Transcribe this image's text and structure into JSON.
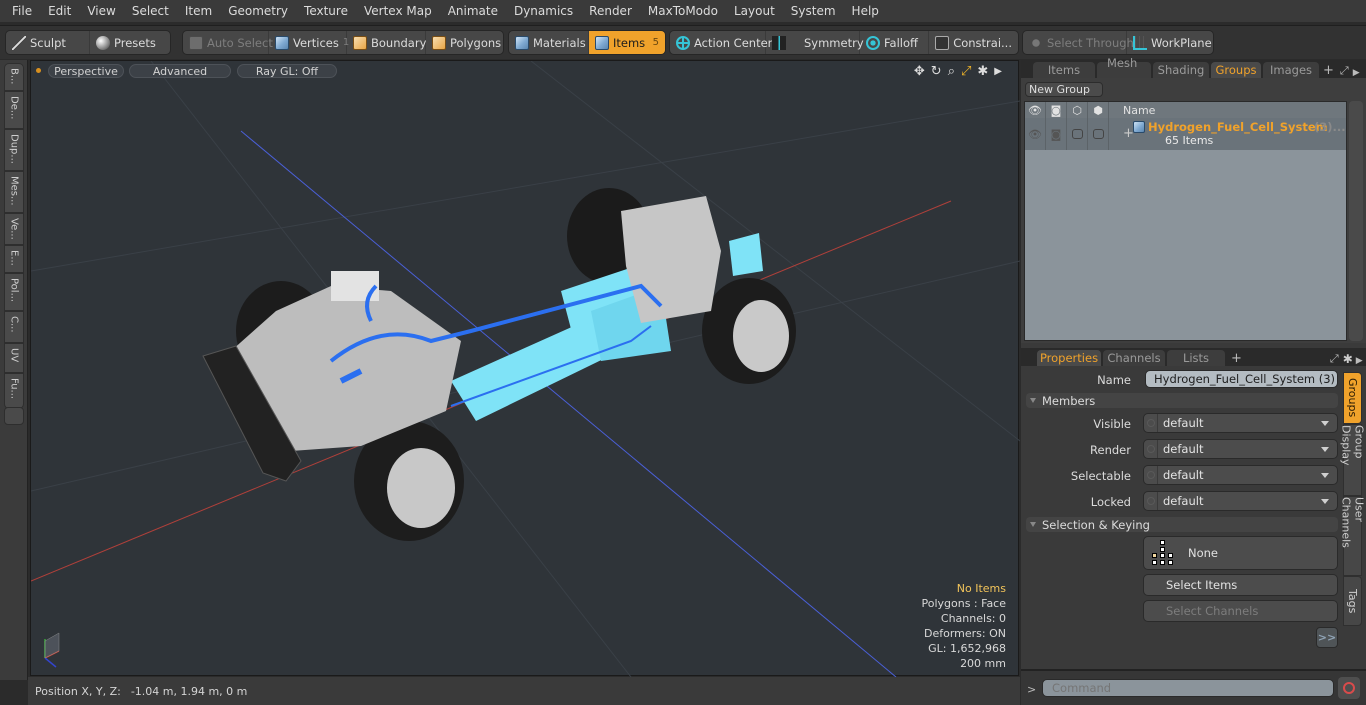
{
  "menu": [
    "File",
    "Edit",
    "View",
    "Select",
    "Item",
    "Geometry",
    "Texture",
    "Vertex Map",
    "Animate",
    "Dynamics",
    "Render",
    "MaxToModo",
    "Layout",
    "System",
    "Help"
  ],
  "toolbar": {
    "sculpt": "Sculpt",
    "presets": "Presets",
    "auto_select": "Auto Select",
    "vertices": "Vertices",
    "vertices_count": "1",
    "boundary": "Boundary",
    "polygons": "Polygons",
    "materials": "Materials",
    "items": "Items",
    "items_count": "5",
    "action_center": "Action Center",
    "symmetry": "Symmetry",
    "falloff": "Falloff",
    "constraints": "Constrai...",
    "select_through": "Select Through",
    "workplane": "WorkPlane"
  },
  "left_tabs": [
    "B...",
    "De...",
    "Dup...",
    "Mes...",
    "Ve...",
    "E...",
    "Pol...",
    "C...",
    "UV",
    "Fu..."
  ],
  "viewport": {
    "view_mode": "Perspective",
    "shading": "Advanced",
    "raygl": "Ray GL: Off",
    "hud": {
      "selection": "No Items",
      "polygons": "Polygons : Face",
      "channels": "Channels: 0",
      "deformers": "Deformers: ON",
      "gl": "GL: 1,652,968",
      "scale": "200 mm"
    },
    "colors": {
      "x_axis": "#c0392b",
      "z_axis": "#4a5fd6",
      "background": "#2f3439",
      "tank": "#7fe3f7",
      "hose": "#2b6ff0"
    }
  },
  "status": {
    "label": "Position X, Y, Z:",
    "value": "-1.04 m, 1.94 m, 0 m"
  },
  "top_panel": {
    "tabs": [
      "Items",
      "Mesh ...",
      "Shading",
      "Groups",
      "Images"
    ],
    "active_tab": "Groups",
    "new_group": "New Group",
    "column_name": "Name",
    "group": {
      "name": "Hydrogen_Fuel_Cell_System",
      "suffix": "(3)...",
      "count": "65 Items"
    }
  },
  "properties": {
    "tabs": [
      "Properties",
      "Channels",
      "Lists"
    ],
    "active_tab": "Properties",
    "name_label": "Name",
    "name_value": "Hydrogen_Fuel_Cell_System (3)",
    "members_section": "Members",
    "fields": [
      {
        "label": "Visible",
        "value": "default"
      },
      {
        "label": "Render",
        "value": "default"
      },
      {
        "label": "Selectable",
        "value": "default"
      },
      {
        "label": "Locked",
        "value": "default"
      }
    ],
    "selection_section": "Selection & Keying",
    "none_label": "None",
    "select_items": "Select Items",
    "select_channels": "Select Channels",
    "more": ">>",
    "side_tabs": [
      "Groups",
      "Group Display",
      "User Channels",
      "Tags"
    ]
  },
  "command": {
    "prompt": ">",
    "placeholder": "Command"
  },
  "accent": "#f0a22b"
}
